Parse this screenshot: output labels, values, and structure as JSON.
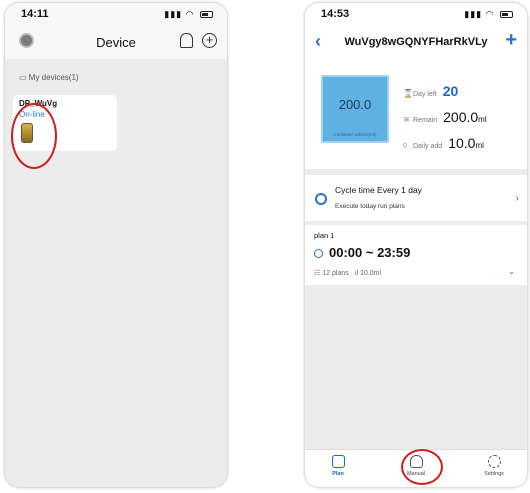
{
  "left_phone": {
    "status_time": "14:11",
    "title": "Device",
    "section_label": "My devices(1)",
    "device": {
      "name": "DP_WuVg",
      "status": "On-line"
    }
  },
  "right_phone": {
    "status_time": "14:53",
    "title": "WuVgy8wGQNYFHarRkVLy",
    "container": {
      "value": "200.0",
      "caption": "Container volume(ml)"
    },
    "stats": {
      "day_left_label": "Day left",
      "day_left_value": "20",
      "remain_label": "Remain",
      "remain_value": "200.0",
      "remain_unit": "ml",
      "daily_add_label": "Daily add",
      "daily_add_value": "10.0",
      "daily_add_unit": "ml"
    },
    "cycle": {
      "title": "Cycle time   Every 1 day",
      "subtitle": "Execute today run plans"
    },
    "plan": {
      "name": "plan 1",
      "time_range": "00:00 ~ 23:59",
      "plans_count": "12 plans",
      "amount": "10.0ml"
    },
    "tabs": [
      {
        "label": "Plan",
        "active": true
      },
      {
        "label": "Manual",
        "active": false
      },
      {
        "label": "Settings",
        "active": false
      }
    ]
  },
  "accent_color": "#1e63d6",
  "highlight_color": "#d01c1c"
}
